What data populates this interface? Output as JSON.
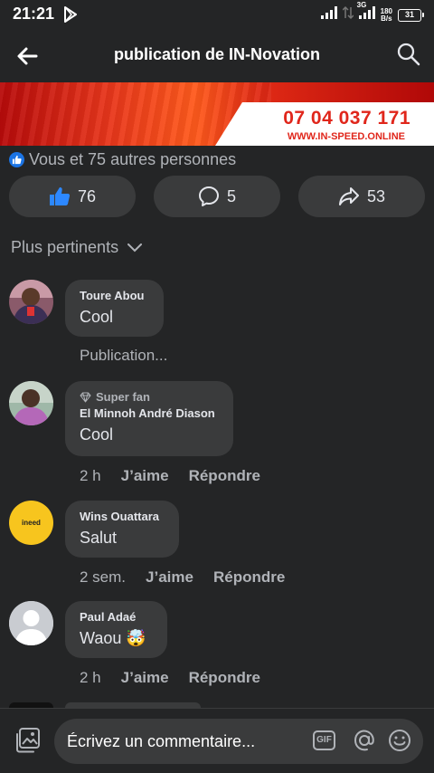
{
  "status_bar": {
    "time": "21:21",
    "net_speed_top": "180",
    "net_speed_bottom": "B/s",
    "network": "3G",
    "battery": "31"
  },
  "header": {
    "title": "publication de IN-Novation"
  },
  "banner": {
    "phone": "07 04 037 171",
    "url": "WWW.IN-SPEED.ONLINE"
  },
  "reactions": {
    "summary": "Vous et 75 autres personnes"
  },
  "actions": {
    "likes": "76",
    "comments": "5",
    "shares": "53"
  },
  "sort": {
    "label": "Plus pertinents"
  },
  "comments": [
    {
      "name": "Toure Abou",
      "text": "Cool",
      "status": "Publication..."
    },
    {
      "badge": "Super fan",
      "name": "El Minnoh André Diason",
      "text": "Cool",
      "time": "2 h",
      "like": "J’aime",
      "reply": "Répondre"
    },
    {
      "avatar_text": "ineed",
      "name": "Wins Ouattara",
      "text": "Salut",
      "time": "2 sem.",
      "like": "J’aime",
      "reply": "Répondre"
    },
    {
      "name": "Paul Adaé",
      "text": "Waou 🤯",
      "time": "2 h",
      "like": "J’aime",
      "reply": "Répondre"
    }
  ],
  "composer": {
    "placeholder": "Écrivez un commentaire...",
    "gif_label": "GIF"
  },
  "colors": {
    "background": "#242526",
    "surface": "#3a3b3c",
    "accent": "#1b74e4",
    "banner_red": "#e0261b",
    "avatar_yellow": "#f7c51e"
  }
}
